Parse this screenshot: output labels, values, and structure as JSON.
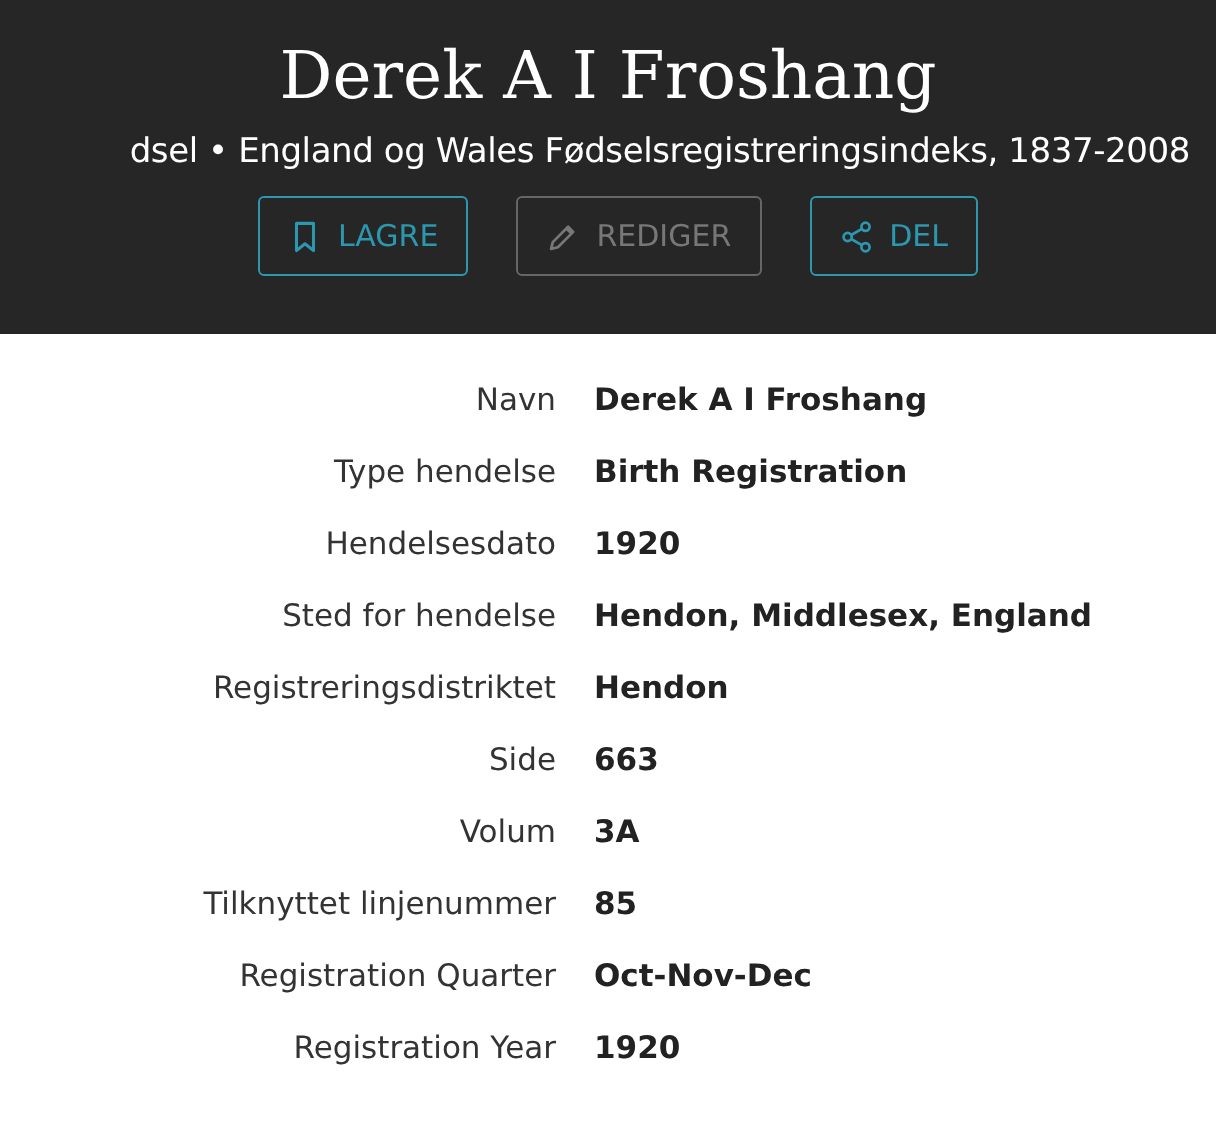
{
  "header": {
    "title": "Derek A I Froshang",
    "subtitle": "dsel • England og Wales Fødselsregistreringsindeks, 1837-2008",
    "buttons": [
      {
        "kind": "save",
        "label": "LAGRE",
        "disabled": false
      },
      {
        "kind": "edit",
        "label": "REDIGER",
        "disabled": true
      },
      {
        "kind": "share",
        "label": "DEL",
        "disabled": false
      }
    ]
  },
  "fields": [
    {
      "label": "Navn",
      "value": "Derek A I Froshang"
    },
    {
      "label": "Type hendelse",
      "value": "Birth Registration"
    },
    {
      "label": "Hendelsesdato",
      "value": "1920"
    },
    {
      "label": "Sted for hendelse",
      "value": "Hendon, Middlesex, England"
    },
    {
      "label": "Registreringsdistriktet",
      "value": "Hendon"
    },
    {
      "label": "Side",
      "value": "663"
    },
    {
      "label": "Volum",
      "value": "3A"
    },
    {
      "label": "Tilknyttet linjenummer",
      "value": "85"
    },
    {
      "label": "Registration Quarter",
      "value": "Oct-Nov-Dec"
    },
    {
      "label": "Registration Year",
      "value": "1920"
    }
  ]
}
